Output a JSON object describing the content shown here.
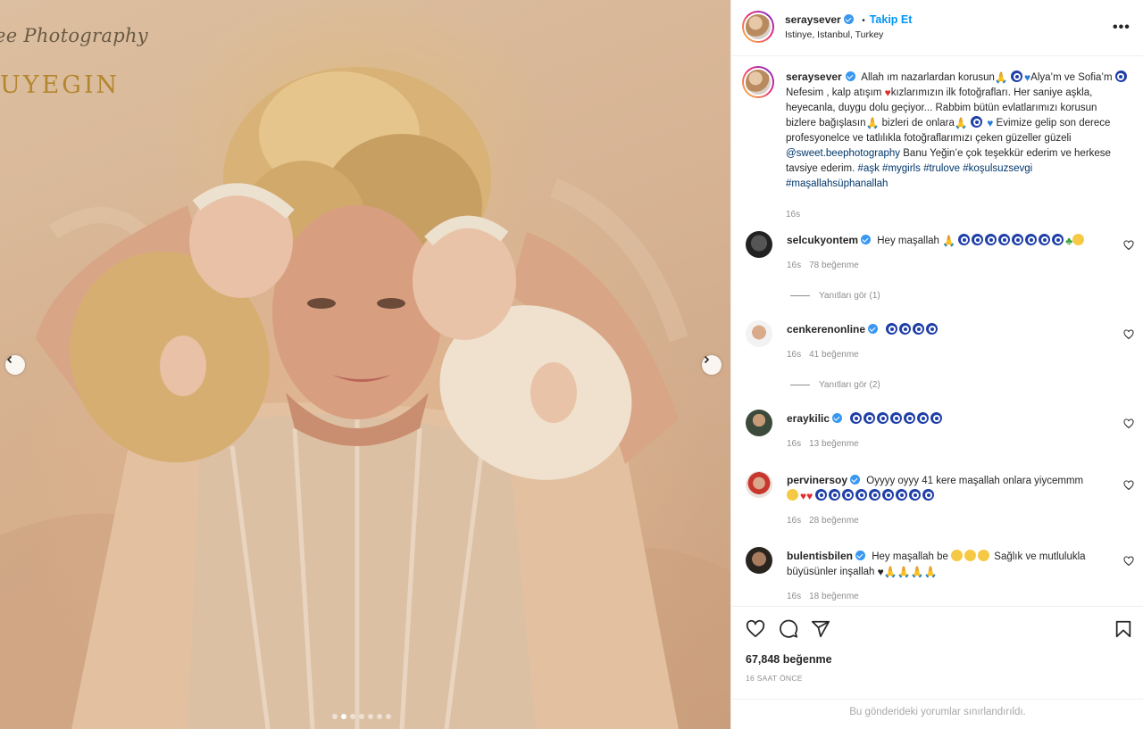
{
  "photo": {
    "watermark_line1": "ee Photography",
    "watermark_line2": "UYEGIN",
    "slide_count": 7,
    "active_slide": 2
  },
  "header": {
    "username": "seraysever",
    "separator": "•",
    "follow_label": "Takip Et",
    "location": "Istinye, Istanbul, Turkey",
    "more_icon": "more-horizontal-icon"
  },
  "caption": {
    "username": "seraysever",
    "part1": "Allah ım nazarlardan korusun",
    "part2": "Alya’m ve Sofia’m",
    "part3": "Nefesim , kalp atışım",
    "part4": "kızlarımızın ilk fotoğrafları. Her saniye aşkla, heyecanla, duygu dolu geçiyor... Rabbim bütün evlatlarımızı korusun bizlere bağışlasın",
    "part5": "bizleri de onlara",
    "part6": "Evimize gelip son derece profesyonelce ve tatlılıkla fotoğraflarımızı çeken güzeller güzeli",
    "mention": "@sweet.beephotography",
    "part7": "Banu Yeğin’e çok teşekkür ederim ve herkese tavsiye ederim.",
    "hashtags": [
      "#aşk",
      "#mygirls",
      "#trulove",
      "#koşulsuzsevgi",
      "#maşallahsüphanallah"
    ],
    "time": "16s"
  },
  "comments": [
    {
      "username": "selcukyontem",
      "verified": true,
      "text": "Hey maşallah",
      "time": "16s",
      "likes": "78 beğenme",
      "replies": "Yanıtları gör (1)"
    },
    {
      "username": "cenkerenonline",
      "verified": true,
      "text": "",
      "time": "16s",
      "likes": "41 beğenme",
      "replies": "Yanıtları gör (2)"
    },
    {
      "username": "eraykilic",
      "verified": true,
      "text": "",
      "time": "16s",
      "likes": "13 beğenme",
      "replies": ""
    },
    {
      "username": "pervinersoy",
      "verified": true,
      "text": "Oyyyy oyyy 41 kere maşallah onlara yiycemmm",
      "time": "16s",
      "likes": "28 beğenme",
      "replies": ""
    },
    {
      "username": "bulentisbilen",
      "verified": true,
      "text_a": "Hey maşallah be",
      "text_b": "Sağlık ve mutlulukla büyüsünler inşallah",
      "time": "16s",
      "likes": "18 beğenme",
      "replies": ""
    }
  ],
  "footer": {
    "likes": "67,848 beğenme",
    "time": "16 SAAT ÖNCE",
    "restricted": "Bu gönderideki yorumlar sınırlandırıldı."
  },
  "colors": {
    "accent": "#0095f6",
    "verified": "#3897f0",
    "hashtag": "#00376b",
    "muted": "#8e8e8e"
  }
}
